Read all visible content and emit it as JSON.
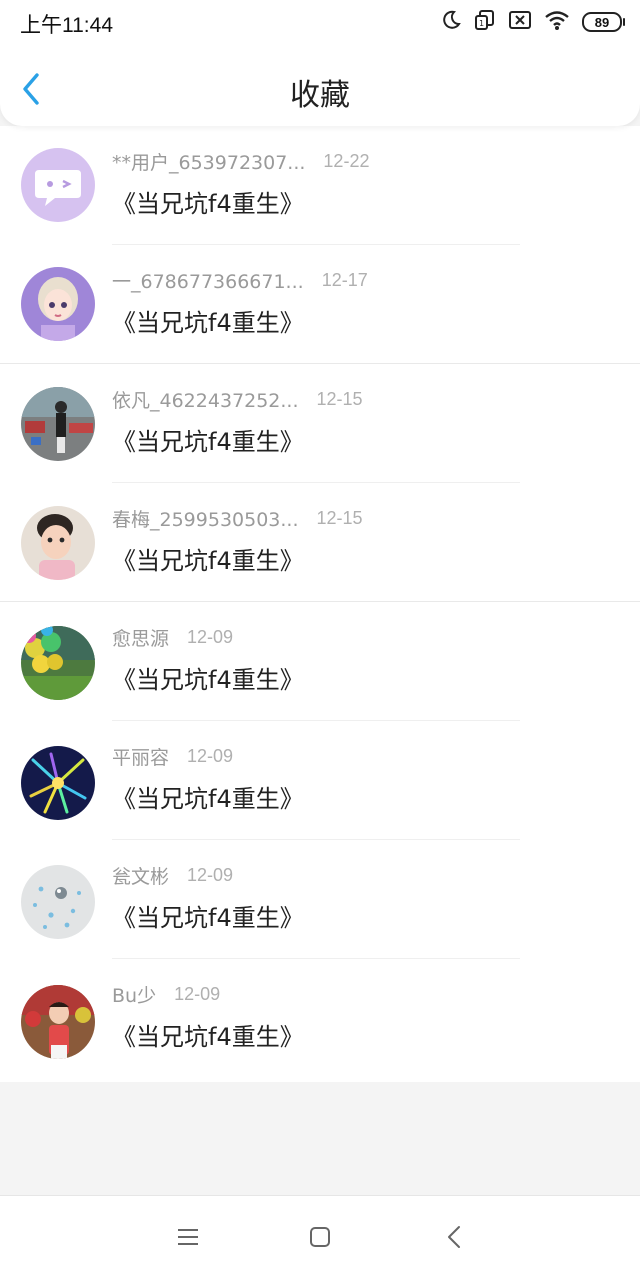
{
  "status_bar": {
    "time": "上午11:44",
    "battery": "89",
    "icons": [
      "moon-icon",
      "sim-icon",
      "no-signal-icon",
      "wifi-icon",
      "battery-icon"
    ]
  },
  "header": {
    "back_icon": "chevron-left-icon",
    "title": "收藏",
    "accent_color": "#2aa1e6"
  },
  "favorites": [
    {
      "name": "**用户_653972307...",
      "date": "12-22",
      "title": "《当兄坑f4重生》",
      "avatar": "chat-bubble-avatar"
    },
    {
      "name": "一_678677366671...",
      "date": "12-17",
      "title": "《当兄坑f4重生》",
      "avatar": "doll-avatar"
    },
    {
      "name": "依凡_4622437252...",
      "date": "12-15",
      "title": "《当兄坑f4重生》",
      "avatar": "photo-avatar"
    },
    {
      "name": "春梅_2599530503...",
      "date": "12-15",
      "title": "《当兄坑f4重生》",
      "avatar": "child-photo-avatar"
    },
    {
      "name": "愈思源",
      "date": "12-09",
      "title": "《当兄坑f4重生》",
      "avatar": "balloons-avatar"
    },
    {
      "name": "平丽容",
      "date": "12-09",
      "title": "《当兄坑f4重生》",
      "avatar": "fireworks-avatar"
    },
    {
      "name": "瓮文彬",
      "date": "12-09",
      "title": "《当兄坑f4重生》",
      "avatar": "dots-avatar"
    },
    {
      "name": "Bu少",
      "date": "12-09",
      "title": "《当兄坑f4重生》",
      "avatar": "child-photo-avatar"
    }
  ],
  "nav_bar": {
    "icons": [
      "menu-icon",
      "home-square-icon",
      "back-triangle-icon"
    ]
  }
}
